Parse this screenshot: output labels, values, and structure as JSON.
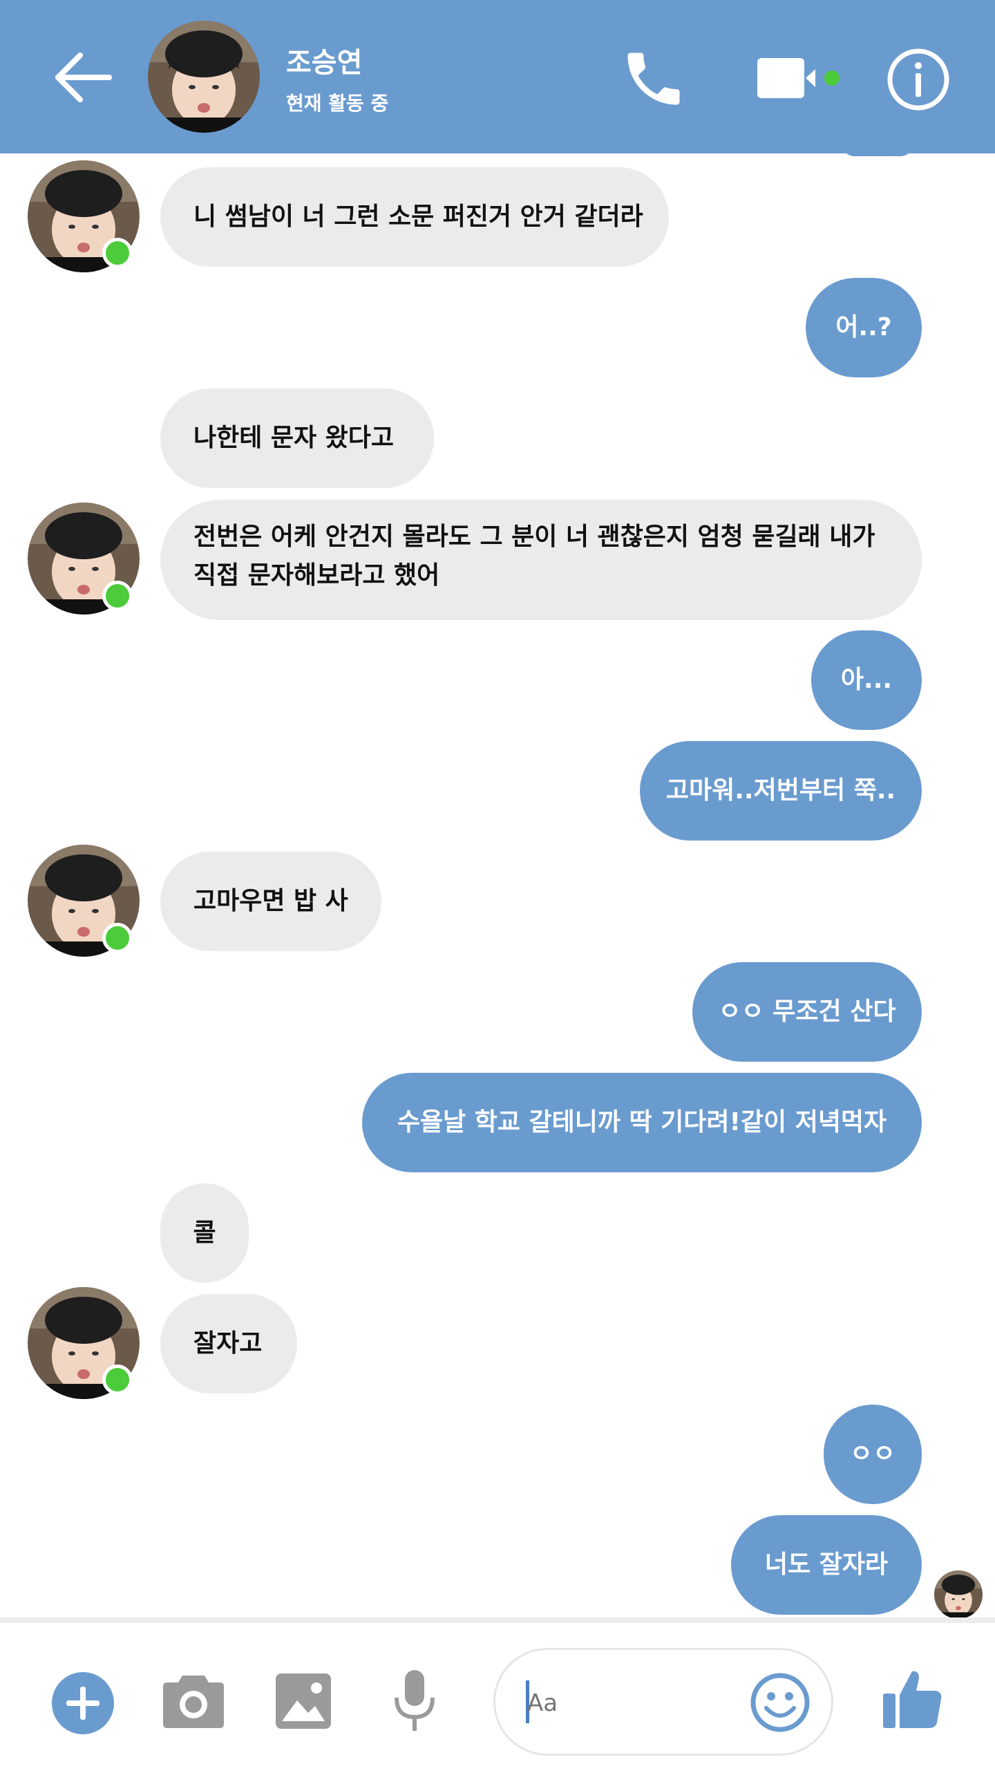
{
  "header": {
    "contact_name": "조승연",
    "status": "현재 활동 중",
    "colors": {
      "bar": "#6a9bcf",
      "online": "#4ccc3a"
    },
    "icons": [
      "back-arrow-icon",
      "phone-icon",
      "video-camera-icon",
      "info-icon"
    ]
  },
  "messages": [
    {
      "side": "in",
      "text": "니 썸남이 너 그런 소문 퍼진거 안거 같더라"
    },
    {
      "side": "out",
      "text": "어..?"
    },
    {
      "side": "in",
      "text": "나한테 문자 왔다고"
    },
    {
      "side": "in",
      "lines": [
        "전번은 어케 안건지 몰라도 그 분이 너 괜찮은지 엄청 묻길래 내가",
        "직접 문자해보라고 했어"
      ]
    },
    {
      "side": "out",
      "text": "아..."
    },
    {
      "side": "out",
      "text": "고마워..저번부터 쭉.."
    },
    {
      "side": "in",
      "text": "고마우면 밥 사"
    },
    {
      "side": "out",
      "text": "ㅇㅇ 무조건 산다"
    },
    {
      "side": "out",
      "text": "수욜날 학교 갈테니까 딱 기다려!같이 저녁먹자"
    },
    {
      "side": "in",
      "text": "콜"
    },
    {
      "side": "in",
      "text": "잘자고"
    },
    {
      "side": "out",
      "text": "ㅇㅇ"
    },
    {
      "side": "out",
      "text": "너도 잘자라"
    }
  ],
  "composer": {
    "placeholder": "Aa",
    "icons": [
      "plus-icon",
      "camera-icon",
      "image-icon",
      "microphone-icon",
      "emoji-icon",
      "thumbs-up-icon"
    ]
  }
}
